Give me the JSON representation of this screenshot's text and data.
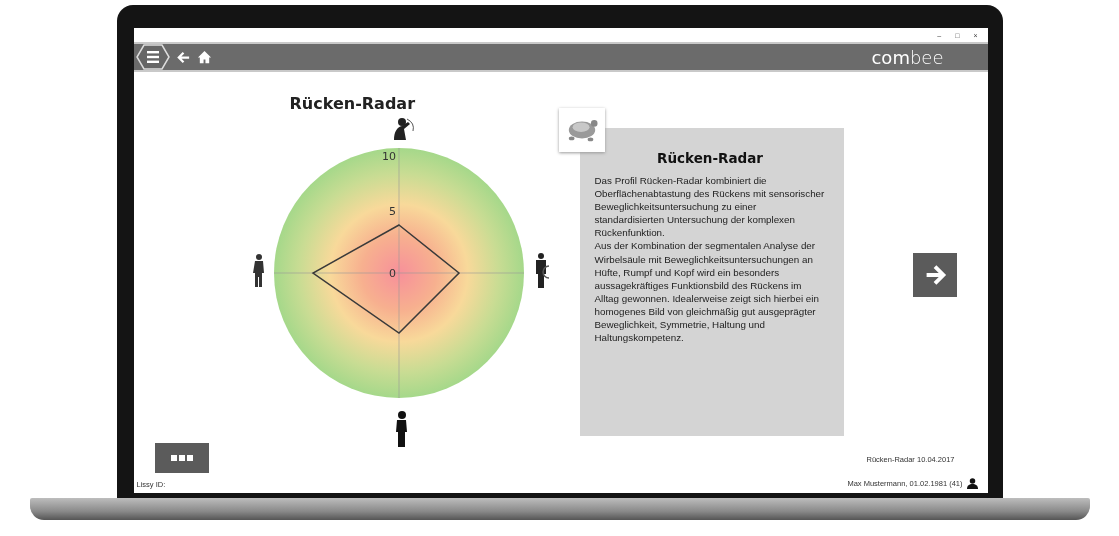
{
  "window": {
    "controls": [
      "–",
      "□",
      "×"
    ]
  },
  "toolbar": {
    "logo": "**com**bee"
  },
  "radar": {
    "title": "Rücken-Radar",
    "ticks": [
      "10",
      "5",
      "0"
    ]
  },
  "info": {
    "title": "Rücken-Radar",
    "paragraphs": [
      "Das Profil Rücken-Radar kombiniert die Oberflächenabtastung des Rückens mit sensorischer Beweglichkeitsuntersuchung zu einer standardisierten Untersuchung der komplexen Rückenfunktion.",
      "Aus der Kombination der segmentalen Analyse der Wirbelsäule mit Beweglichkeitsuntersuchungen an Hüfte, Rumpf und Kopf wird ein besonders aussagekräftiges Funktionsbild des Rückens im Alltag gewonnen. Idealerweise zeigt sich hierbei ein homogenes Bild von gleichmäßig gut ausgeprägter Beweglichkeit, Symmetrie, Haltung und Haltungskompetenz."
    ]
  },
  "footer": {
    "id_label": "Lissy ID:",
    "report": "Rücken-Radar 10.04.2017",
    "patient": "Max Mustermann, 01.02.1981 (41)"
  }
}
